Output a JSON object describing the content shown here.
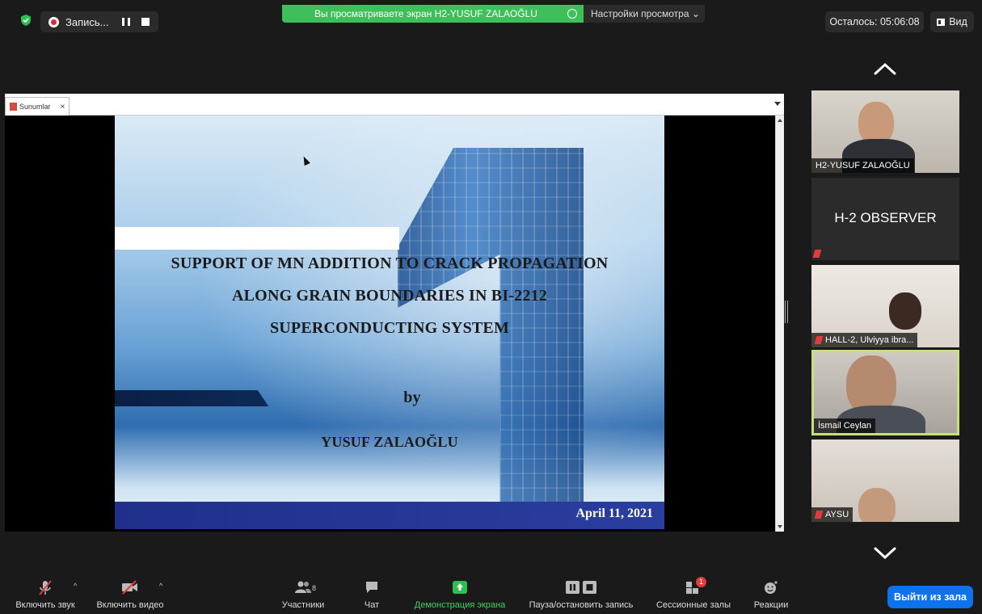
{
  "topbar": {
    "recording_label": "Запись...",
    "share_banner": "Вы просматриваете экран H2-YUSUF ZALAOĞLU",
    "view_settings": "Настройки просмотра ⌄",
    "timer": "Осталось: 05:06:08",
    "view_button": "Вид"
  },
  "shared_screen": {
    "tab_label": "Sunumlar",
    "tab_close": "×",
    "slide": {
      "title_line1": "SUPPORT OF MN ADDITION TO CRACK PROPAGATION",
      "title_line2": "ALONG GRAIN BOUNDARIES IN BI-2212",
      "title_line3": "SUPERCONDUCTING SYSTEM",
      "by": "by",
      "author": "YUSUF ZALAOĞLU",
      "date": "April 11, 2021"
    }
  },
  "participants": [
    {
      "name": "H2-YUSUF ZALAOĞLU",
      "muted": false
    },
    {
      "name": "H-2 OBSERVER",
      "muted": true
    },
    {
      "name": "HALL-2, Ulviyya ibra...",
      "muted": true
    },
    {
      "name": "İsmail Ceylan",
      "muted": false,
      "active_speaker": true
    },
    {
      "name": "AYSU",
      "muted": true
    }
  ],
  "toolbar": {
    "unmute": "Включить звук",
    "start_video": "Включить видео",
    "participants": "Участники",
    "participants_count": "8",
    "chat": "Чат",
    "share_screen": "Демонстрация экрана",
    "pause_recording": "Пауза/остановить запись",
    "breakout_rooms": "Сессионные залы",
    "breakout_badge": "1",
    "reactions": "Реакции",
    "leave": "Выйти из зала"
  },
  "colors": {
    "share_green": "#3fbf5a",
    "leave_blue": "#0e72ed",
    "speaker_border": "#c8e07a",
    "mute_red": "#e23b3b"
  }
}
